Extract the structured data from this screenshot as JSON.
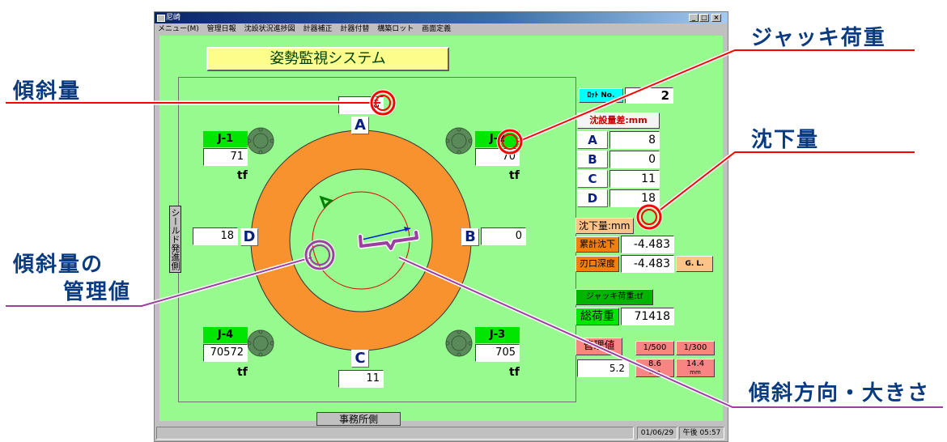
{
  "window": {
    "title": "尼崎",
    "menu": [
      "メニュー(M)",
      "管理日報",
      "沈設状況進捗図",
      "計器補正",
      "計器付替",
      "構築ロット",
      "画面定義"
    ]
  },
  "header": {
    "title": "姿勢監視システム"
  },
  "diagram": {
    "side_label_top": "シールド発進側",
    "side_label_bottom": "事務所側",
    "points": {
      "A": {
        "label": "A",
        "value": "8"
      },
      "B": {
        "label": "B",
        "value": "0"
      },
      "C": {
        "label": "C",
        "value": "11"
      },
      "D": {
        "label": "D",
        "value": "18"
      }
    },
    "jacks": [
      {
        "label": "J-1",
        "value": "71",
        "unit": "tf"
      },
      {
        "label": "J-2",
        "value": "70",
        "unit": "tf"
      },
      {
        "label": "J-3",
        "value": "705",
        "unit": "tf"
      },
      {
        "label": "J-4",
        "value": "70572",
        "unit": "tf"
      }
    ],
    "colors": {
      "ring": "#f7922e",
      "limit_circle": "#e00000",
      "tilt_vector": "#0020e0",
      "marker": "#008000"
    }
  },
  "panel": {
    "lot_label": "ﾛｯﾄ No.",
    "lot_value": "2",
    "settle_diff_label": "沈設量差:mm",
    "diffs": [
      {
        "label": "A",
        "value": "8"
      },
      {
        "label": "B",
        "value": "0"
      },
      {
        "label": "C",
        "value": "11"
      },
      {
        "label": "D",
        "value": "18"
      }
    ],
    "settlement_label": "沈下量:mm",
    "cumulative_label": "累計沈下",
    "cumulative_value": "-4.483",
    "edge_depth_label": "刃口深度",
    "edge_depth_value": "-4.483",
    "gl_label": "G. L.",
    "jack_load_label": "ジャッキ荷重:tf",
    "total_load_label": "総荷重",
    "total_load_value": "71418",
    "control_label": "管理値",
    "control_value": "5.2",
    "ratio1": "1/500",
    "ratio2": "1/300",
    "mm1": "8.6",
    "mm2": "14.4",
    "mm_unit": "mm"
  },
  "status": {
    "date": "01/06/29",
    "time": "午後 05:57"
  },
  "annotations": {
    "tilt": "傾斜量",
    "tilt_control_line1": "傾斜量の",
    "tilt_control_line2": "管理値",
    "jack_load": "ジャッキ荷重",
    "settlement": "沈下量",
    "tilt_direction": "傾斜方向・大きさ",
    "colors": {
      "red": "#ff0000",
      "purple": "#9b3fa0",
      "text": "#0a3a80"
    }
  }
}
